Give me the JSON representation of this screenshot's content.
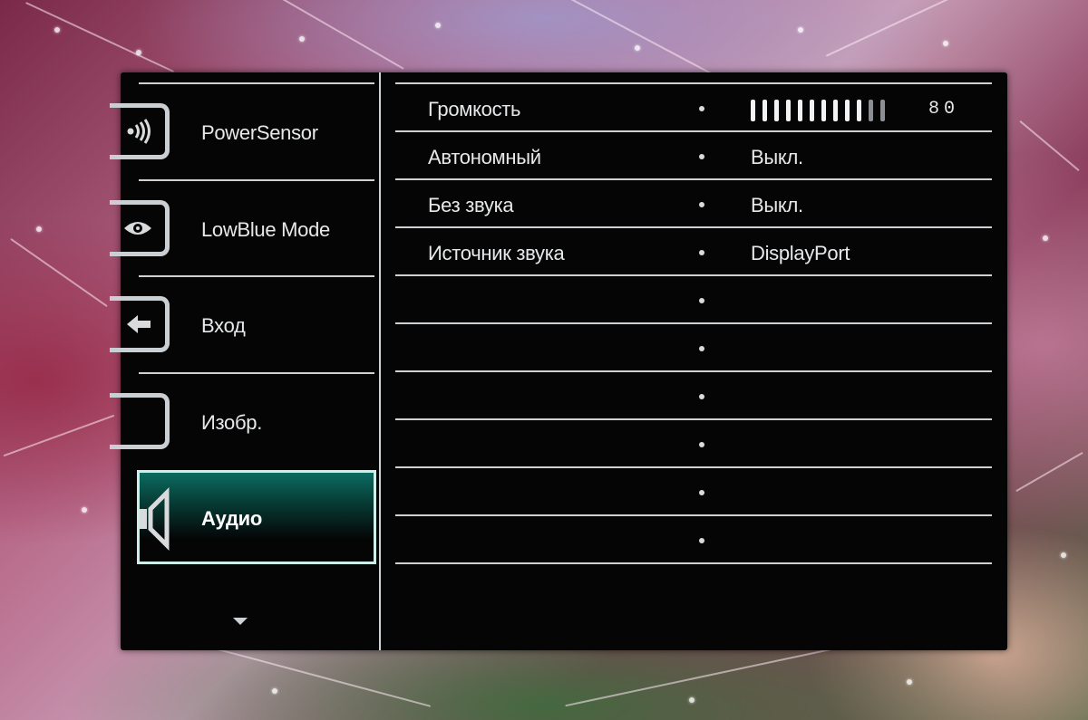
{
  "sidebar": {
    "items": [
      {
        "label": "PowerSensor",
        "icon": "power-sensor-icon",
        "selected": false
      },
      {
        "label": "LowBlue Mode",
        "icon": "eye-icon",
        "selected": false
      },
      {
        "label": "Вход",
        "icon": "input-arrow-icon",
        "selected": false
      },
      {
        "label": "Изобр.",
        "icon": "picture-icon",
        "selected": false
      },
      {
        "label": "Аудио",
        "icon": "speaker-icon",
        "selected": true
      }
    ],
    "more_icon": "chevron-down-icon"
  },
  "settings": {
    "rows": [
      {
        "name": "Громкость",
        "value": "",
        "volume": 80,
        "volume_display": "80"
      },
      {
        "name": "Автономный",
        "value": "Выкл."
      },
      {
        "name": "Без звука",
        "value": "Выкл."
      },
      {
        "name": "Источник звука",
        "value": "DisplayPort"
      },
      {
        "name": "",
        "value": ""
      },
      {
        "name": "",
        "value": ""
      },
      {
        "name": "",
        "value": ""
      },
      {
        "name": "",
        "value": ""
      },
      {
        "name": "",
        "value": ""
      },
      {
        "name": "",
        "value": ""
      }
    ]
  },
  "colors": {
    "osd_background": "#050505",
    "separator": "#cfd2d4",
    "selection_border": "#cdeee9",
    "selection_accent": "#0b6b60"
  }
}
